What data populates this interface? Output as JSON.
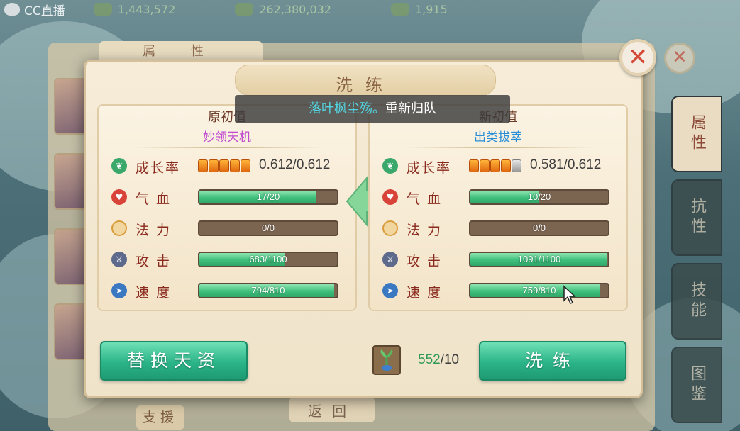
{
  "topbar": {
    "app_name": "CC直播",
    "resource_1": "1,443,572",
    "resource_2": "262,380,032",
    "resource_3": "1,915"
  },
  "background": {
    "tab_attr": "属 性",
    "support_label": "支援",
    "back_label": "返回",
    "side_tabs": [
      "属性",
      "抗性",
      "技能",
      "图鉴"
    ]
  },
  "dialog": {
    "title": "洗练",
    "toast_highlight": "落叶枫尘殇。",
    "toast_rest": "重新归队",
    "left": {
      "title": "原初值",
      "subtitle": "妙领天机",
      "growth_label": "成长率",
      "growth_value": "0.612/0.612",
      "growth_stars": 5,
      "stats": [
        {
          "label": "气血",
          "text": "17/20",
          "fill": 0.85
        },
        {
          "label": "法力",
          "text": "0/0",
          "fill": 0
        },
        {
          "label": "攻击",
          "text": "683/1100",
          "fill": 0.62
        },
        {
          "label": "速度",
          "text": "794/810",
          "fill": 0.98
        }
      ]
    },
    "right": {
      "title": "新初值",
      "subtitle": "出类拔萃",
      "growth_label": "成长率",
      "growth_value": "0.581/0.612",
      "growth_stars": 4,
      "stats": [
        {
          "label": "气血",
          "text": "10/20",
          "fill": 0.5
        },
        {
          "label": "法力",
          "text": "0/0",
          "fill": 0
        },
        {
          "label": "攻击",
          "text": "1091/1100",
          "fill": 0.99
        },
        {
          "label": "速度",
          "text": "759/810",
          "fill": 0.94
        }
      ]
    },
    "replace_button": "替换天资",
    "refine_button": "洗练",
    "cost_have": "552",
    "cost_need": "/10"
  },
  "colors": {
    "accent_green": "#2bb487",
    "label_red": "#8a2a1e",
    "close_red": "#d44a38"
  }
}
